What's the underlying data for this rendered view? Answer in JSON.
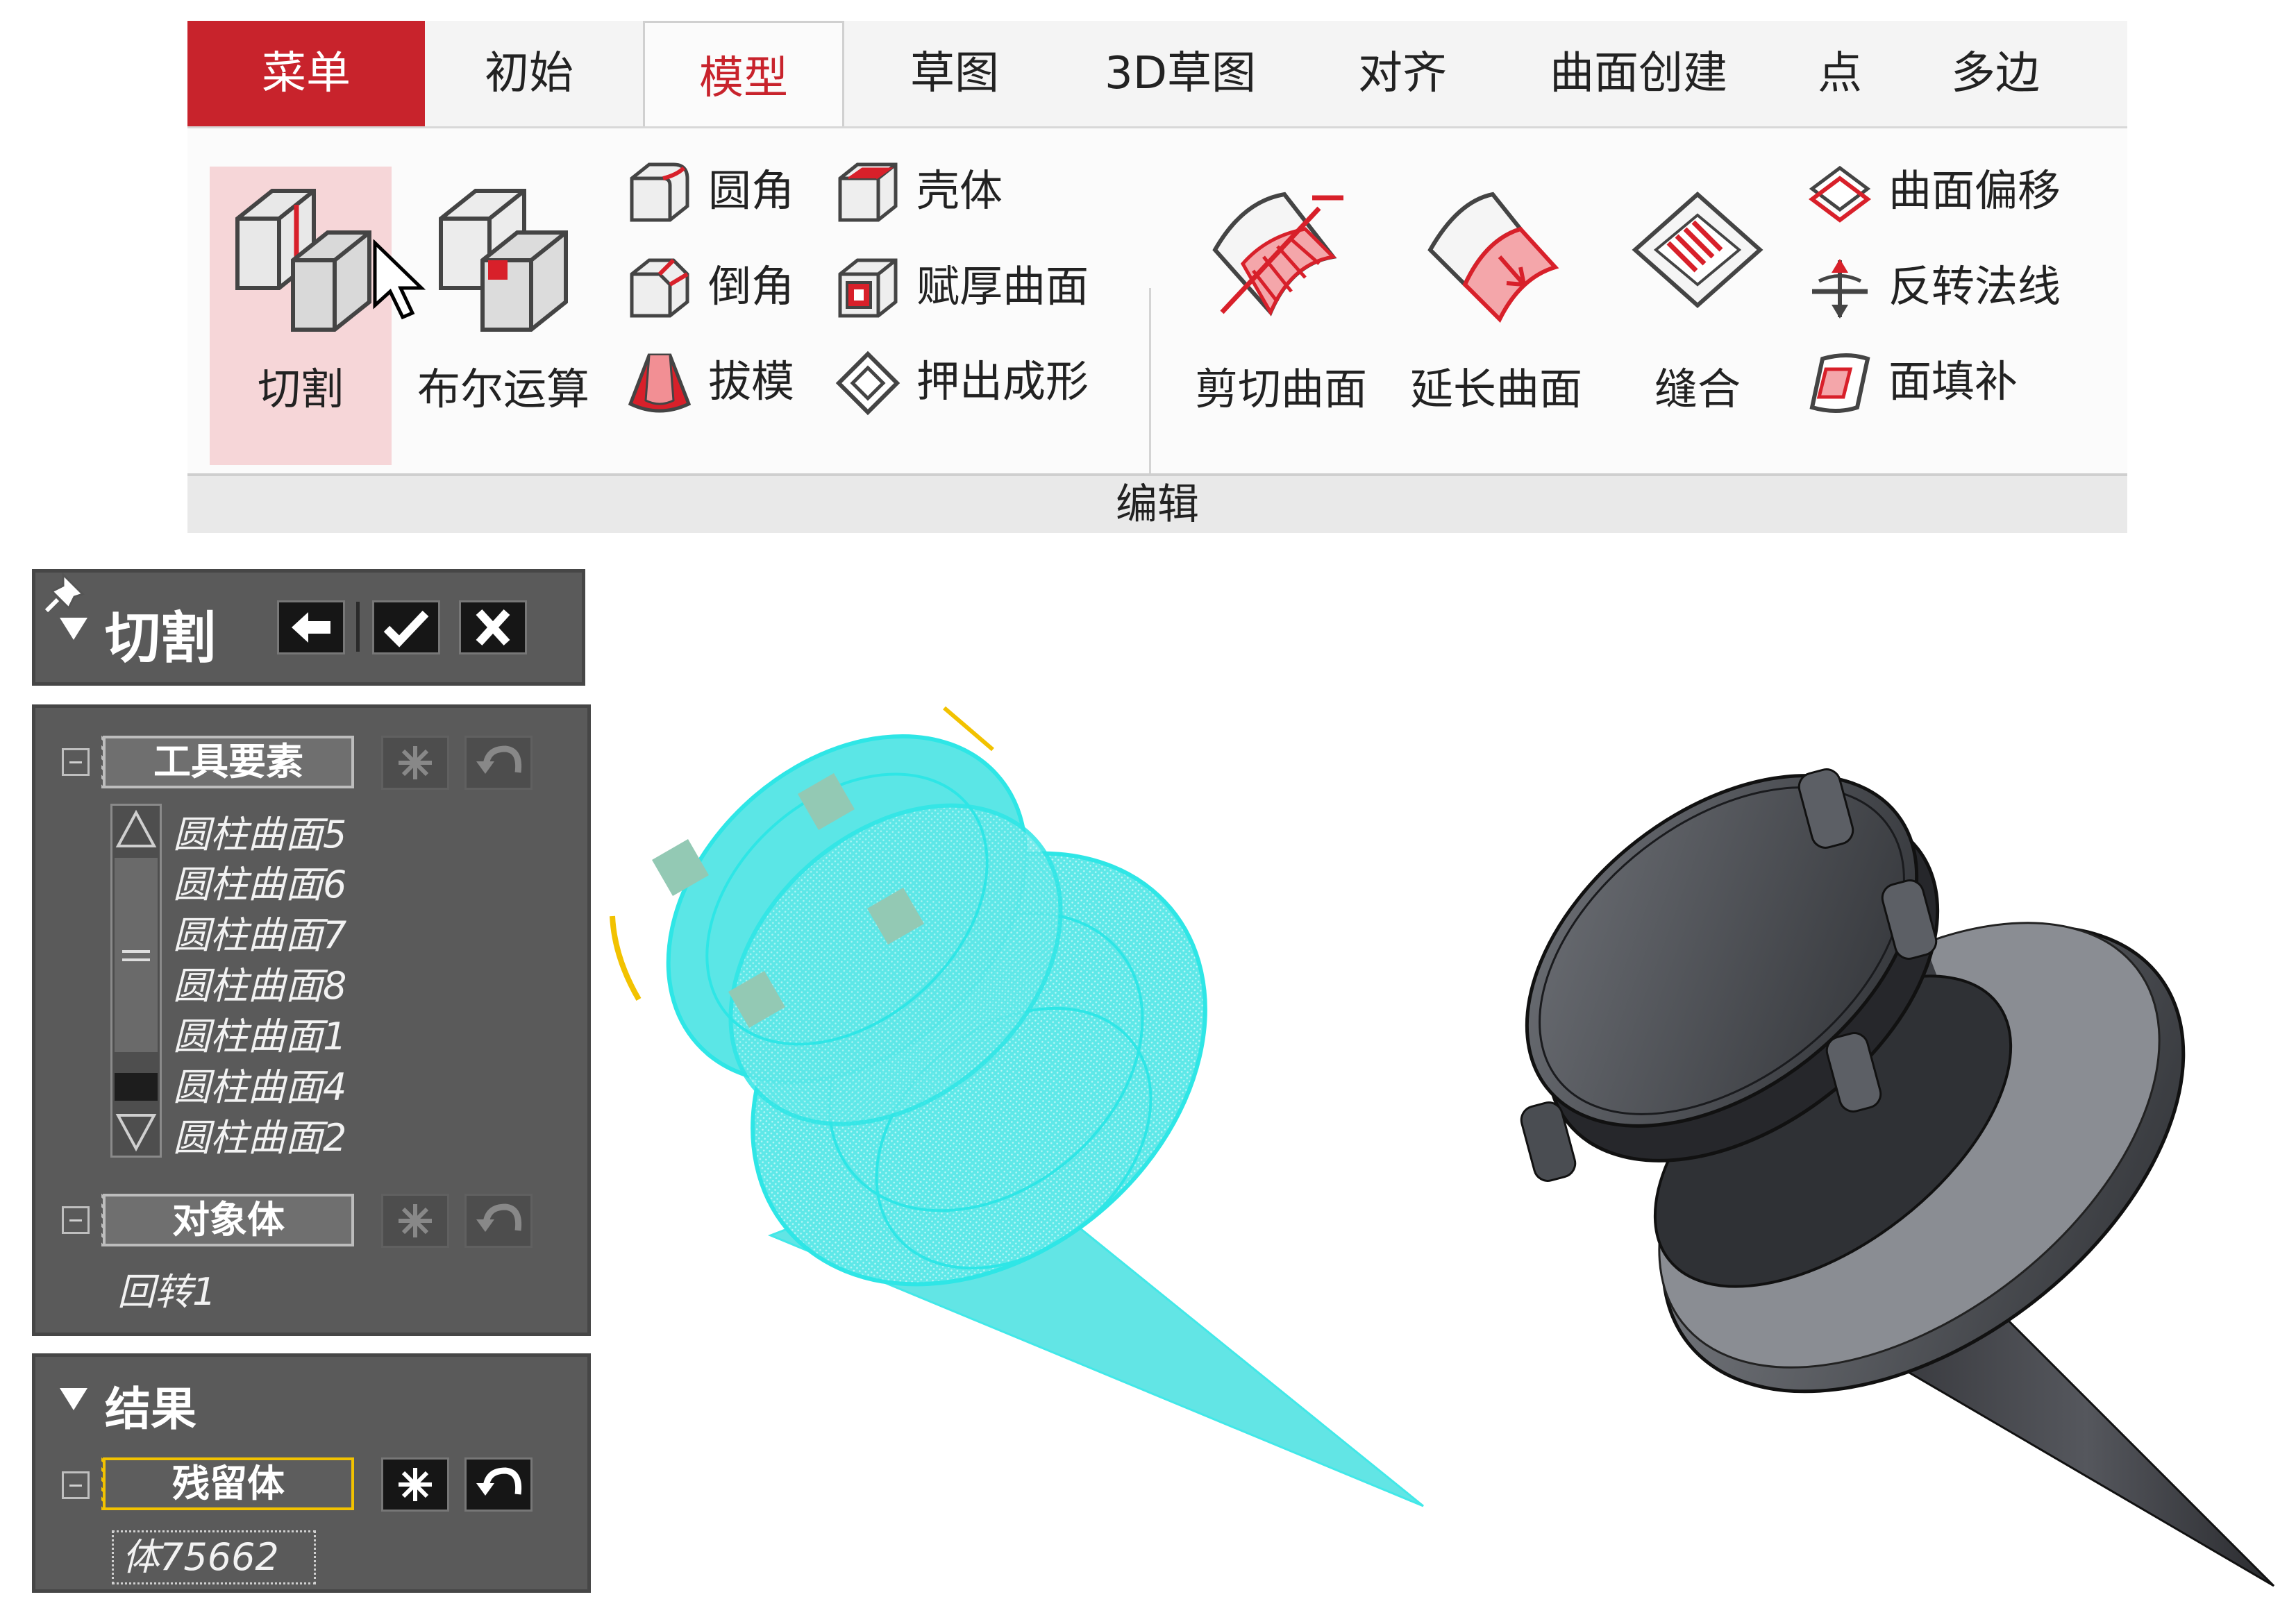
{
  "ribbon": {
    "tabs": [
      "菜单",
      "初始",
      "模型",
      "草图",
      "3D草图",
      "对齐",
      "曲面创建",
      "点",
      "多边"
    ],
    "active_tab": "模型",
    "group_label": "编辑",
    "big_buttons": {
      "cut": "切割",
      "boolean": "布尔运算",
      "trim_surface": "剪切曲面",
      "extend_surface": "延长曲面",
      "stitch": "缝合"
    },
    "small_buttons": {
      "fillet": "圆角",
      "chamfer": "倒角",
      "draft": "拔模",
      "shell": "壳体",
      "thicken": "赋厚曲面",
      "emboss": "押出成形",
      "offset_surface": "曲面偏移",
      "reverse_normal": "反转法线",
      "fill_face": "面填补"
    }
  },
  "command_panel": {
    "title": "切割"
  },
  "inputs_panel": {
    "tool_section": {
      "label": "工具要素",
      "items": [
        "圆柱曲面5",
        "圆柱曲面6",
        "圆柱曲面7",
        "圆柱曲面8",
        "圆柱曲面1",
        "圆柱曲面4",
        "圆柱曲面2"
      ]
    },
    "target_section": {
      "label": "对象体",
      "items": [
        "回转1"
      ]
    }
  },
  "result_panel": {
    "title": "结果",
    "keep_section": {
      "label": "残留体",
      "items": [
        "体75662"
      ]
    }
  },
  "colors": {
    "menu_red": "#c8232c",
    "panel_gray": "#5a5a5a",
    "highlight_yellow": "#f2c200",
    "wireframe_cyan": "#2ee6e6",
    "solid_gray": "#3d3f45"
  }
}
